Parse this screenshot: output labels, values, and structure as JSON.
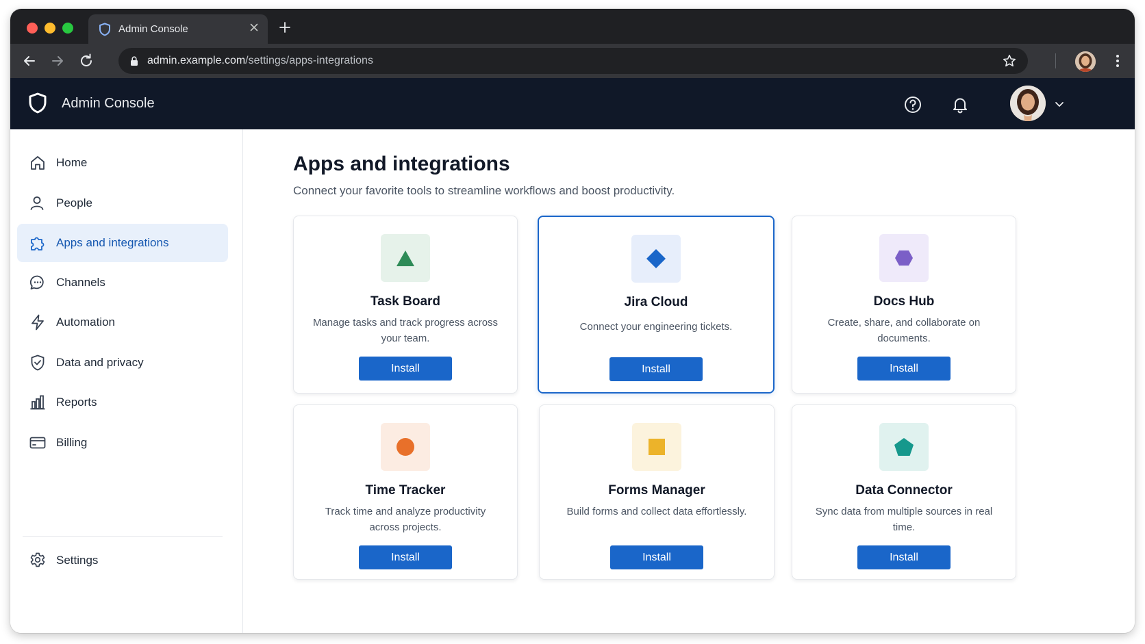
{
  "browser": {
    "tab_title": "Admin Console",
    "url_domain": "admin.example.com",
    "url_path": "/settings/apps-integrations"
  },
  "header": {
    "title": "Admin Console"
  },
  "sidebar": {
    "items": [
      {
        "label": "Home",
        "icon": "home-icon"
      },
      {
        "label": "People",
        "icon": "person-icon"
      },
      {
        "label": "Apps and integrations",
        "icon": "puzzle-icon",
        "active": true
      },
      {
        "label": "Channels",
        "icon": "chat-icon"
      },
      {
        "label": "Automation",
        "icon": "lightning-icon"
      },
      {
        "label": "Data and privacy",
        "icon": "shield-check-icon"
      },
      {
        "label": "Reports",
        "icon": "bar-chart-icon"
      },
      {
        "label": "Billing",
        "icon": "credit-card-icon"
      }
    ],
    "settings_label": "Settings"
  },
  "main": {
    "title": "Apps and integrations",
    "subtitle": "Connect your favorite tools to streamline workflows and boost productivity."
  },
  "apps": [
    {
      "name": "Task Board",
      "description": "Manage tasks and track progress across your team.",
      "button": "Install",
      "icon": "triangle-icon",
      "color": "#2e8b57",
      "tile": "#e6f2ea"
    },
    {
      "name": "Jira Cloud",
      "description": "Connect your engineering tickets.",
      "button": "Install",
      "icon": "diamond-icon",
      "color": "#1a66c9",
      "tile": "#e7eefb",
      "selected": true
    },
    {
      "name": "Docs Hub",
      "description": "Create, share, and collaborate on documents.",
      "button": "Install",
      "icon": "hexagon-icon",
      "color": "#7b5fc7",
      "tile": "#efeafa"
    },
    {
      "name": "Time Tracker",
      "description": "Track time and analyze productivity across projects.",
      "button": "Install",
      "icon": "circle-icon",
      "color": "#e8702a",
      "tile": "#fcece2"
    },
    {
      "name": "Forms Manager",
      "description": "Build forms and collect data effortlessly.",
      "button": "Install",
      "icon": "square-icon",
      "color": "#ecb32a",
      "tile": "#fcf3dd"
    },
    {
      "name": "Data Connector",
      "description": "Sync data from multiple sources in real time.",
      "button": "Install",
      "icon": "pentagon-icon",
      "color": "#16988c",
      "tile": "#e0f2ef"
    }
  ],
  "colors": {
    "accent": "#1a66c9",
    "header_bg": "#101828",
    "active_nav_bg": "#e8f0fb"
  }
}
